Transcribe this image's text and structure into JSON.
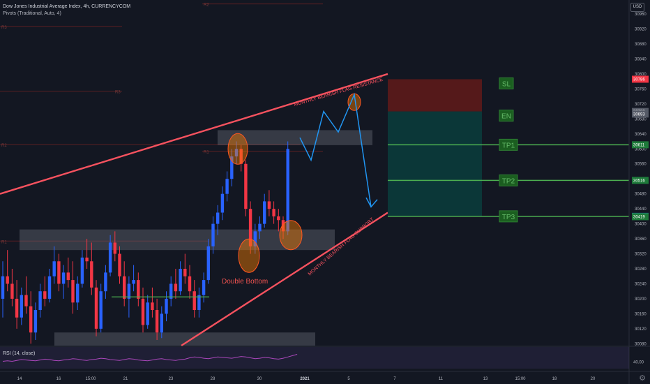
{
  "header": {
    "symbol_line": "Dow Jones Industrial Average Index, 4h, CURRENCYCOM",
    "indicator_line": "Pivots (Traditional, Auto, 4)",
    "currency": "USD"
  },
  "rsi": {
    "label": "RSI (14, close)",
    "axis_label": "40.00",
    "values": [
      42,
      43,
      42,
      44,
      46,
      45,
      44,
      43,
      45,
      47,
      46,
      44,
      43,
      45,
      46,
      48,
      47,
      45,
      44,
      46,
      47,
      49,
      48,
      46,
      45,
      44,
      46,
      48,
      47,
      45,
      44,
      43,
      45,
      47,
      48,
      46,
      45,
      44,
      46,
      47,
      50,
      52,
      51,
      49,
      48,
      50,
      52,
      51,
      50,
      49,
      51,
      53,
      52,
      50,
      48,
      49,
      51,
      50,
      48,
      47,
      49,
      52,
      55,
      58
    ]
  },
  "chart_data": {
    "type": "candlestick",
    "title": "Dow Jones Industrial Average Index, 4h, CURRENCYCOM",
    "ylim": [
      30075,
      30990
    ],
    "y_ticks": [
      30960,
      30920,
      30880,
      30840,
      30800,
      30760,
      30720,
      30680,
      30640,
      30600,
      30560,
      30520,
      30480,
      30440,
      30400,
      30360,
      30320,
      30280,
      30240,
      30200,
      30160,
      30120,
      30080
    ],
    "x_ticks": [
      "14",
      "16",
      "15:00",
      "21",
      "23",
      "28",
      "30",
      "2021",
      "5",
      "7",
      "11",
      "13",
      "15:00",
      "18",
      "20"
    ],
    "pivots": [
      {
        "name": "R2",
        "value": 30987
      },
      {
        "name": "R3",
        "value": 30927
      },
      {
        "name": "R3",
        "value": 30754
      },
      {
        "name": "R2",
        "value": 30612
      },
      {
        "name": "R1",
        "value": 30594
      },
      {
        "name": "R1",
        "value": 30354
      }
    ],
    "price_labels": [
      {
        "name": "SL",
        "value": 30786
      },
      {
        "name": "EN",
        "value": 30700
      },
      {
        "name": "",
        "value": 30693
      },
      {
        "name": "TP1",
        "value": 30611
      },
      {
        "name": "TP2",
        "value": 30516
      },
      {
        "name": "TP3",
        "value": 30420
      },
      {
        "name": "",
        "value": 30419
      }
    ],
    "annotations": [
      {
        "text": "Double Bottom",
        "color": "#ef5350"
      },
      {
        "text": "MONTHLY BEARISH FLAG RESISTANCE",
        "color": "#f7525f"
      },
      {
        "text": "MONTHLY BEARISH FLAG SUPPORT",
        "color": "#f7525f"
      }
    ],
    "series": [
      {
        "name": "",
        "values": [
          [
            30200,
            30300,
            30150,
            30260
          ],
          [
            30260,
            30330,
            30220,
            30240
          ],
          [
            30240,
            30280,
            30180,
            30200
          ],
          [
            30200,
            30250,
            30120,
            30150
          ],
          [
            30150,
            30230,
            30130,
            30210
          ],
          [
            30210,
            30260,
            30160,
            30180
          ],
          [
            30180,
            30220,
            30080,
            30110
          ],
          [
            30110,
            30190,
            30090,
            30170
          ],
          [
            30170,
            30240,
            30150,
            30220
          ],
          [
            30220,
            30260,
            30180,
            30200
          ],
          [
            30200,
            30280,
            30190,
            30260
          ],
          [
            30260,
            30340,
            30240,
            30300
          ],
          [
            30300,
            30320,
            30220,
            30240
          ],
          [
            30240,
            30290,
            30200,
            30270
          ],
          [
            30270,
            30310,
            30230,
            30250
          ],
          [
            30250,
            30300,
            30160,
            30190
          ],
          [
            30190,
            30260,
            30170,
            30240
          ],
          [
            30240,
            30330,
            30230,
            30310
          ],
          [
            30310,
            30360,
            30280,
            30300
          ],
          [
            30300,
            30350,
            30210,
            30230
          ],
          [
            30230,
            30250,
            30100,
            30120
          ],
          [
            30120,
            30240,
            30110,
            30220
          ],
          [
            30220,
            30290,
            30200,
            30270
          ],
          [
            30270,
            30370,
            30260,
            30350
          ],
          [
            30350,
            30380,
            30300,
            30320
          ],
          [
            30320,
            30340,
            30240,
            30260
          ],
          [
            30260,
            30300,
            30180,
            30200
          ],
          [
            30200,
            30260,
            30150,
            30240
          ],
          [
            30240,
            30290,
            30220,
            30250
          ],
          [
            30250,
            30270,
            30180,
            30200
          ],
          [
            30200,
            30230,
            30110,
            30130
          ],
          [
            30130,
            30210,
            30120,
            30190
          ],
          [
            30190,
            30230,
            30150,
            30170
          ],
          [
            30170,
            30200,
            30090,
            30110
          ],
          [
            30110,
            30180,
            30095,
            30160
          ],
          [
            30160,
            30220,
            30140,
            30200
          ],
          [
            30200,
            30260,
            30180,
            30240
          ],
          [
            30240,
            30280,
            30200,
            30220
          ],
          [
            30220,
            30300,
            30210,
            30280
          ],
          [
            30280,
            30320,
            30240,
            30260
          ],
          [
            30260,
            30290,
            30200,
            30220
          ],
          [
            30220,
            30250,
            30150,
            30170
          ],
          [
            30170,
            30230,
            30150,
            30210
          ],
          [
            30210,
            30270,
            30190,
            30250
          ],
          [
            30250,
            30360,
            30240,
            30340
          ],
          [
            30340,
            30420,
            30320,
            30400
          ],
          [
            30400,
            30450,
            30370,
            30430
          ],
          [
            30430,
            30500,
            30410,
            30480
          ],
          [
            30480,
            30540,
            30460,
            30520
          ],
          [
            30520,
            30600,
            30500,
            30580
          ],
          [
            30580,
            30620,
            30560,
            30600
          ],
          [
            30600,
            30610,
            30540,
            30560
          ],
          [
            30560,
            30570,
            30420,
            30440
          ],
          [
            30440,
            30460,
            30320,
            30340
          ],
          [
            30340,
            30400,
            30320,
            30380
          ],
          [
            30380,
            30420,
            30360,
            30400
          ],
          [
            30400,
            30480,
            30390,
            30460
          ],
          [
            30460,
            30490,
            30420,
            30440
          ],
          [
            30440,
            30460,
            30400,
            30420
          ],
          [
            30420,
            30440,
            30380,
            30410
          ],
          [
            30410,
            30420,
            30360,
            30380
          ],
          [
            30380,
            30620,
            30370,
            30600
          ]
        ]
      }
    ]
  }
}
